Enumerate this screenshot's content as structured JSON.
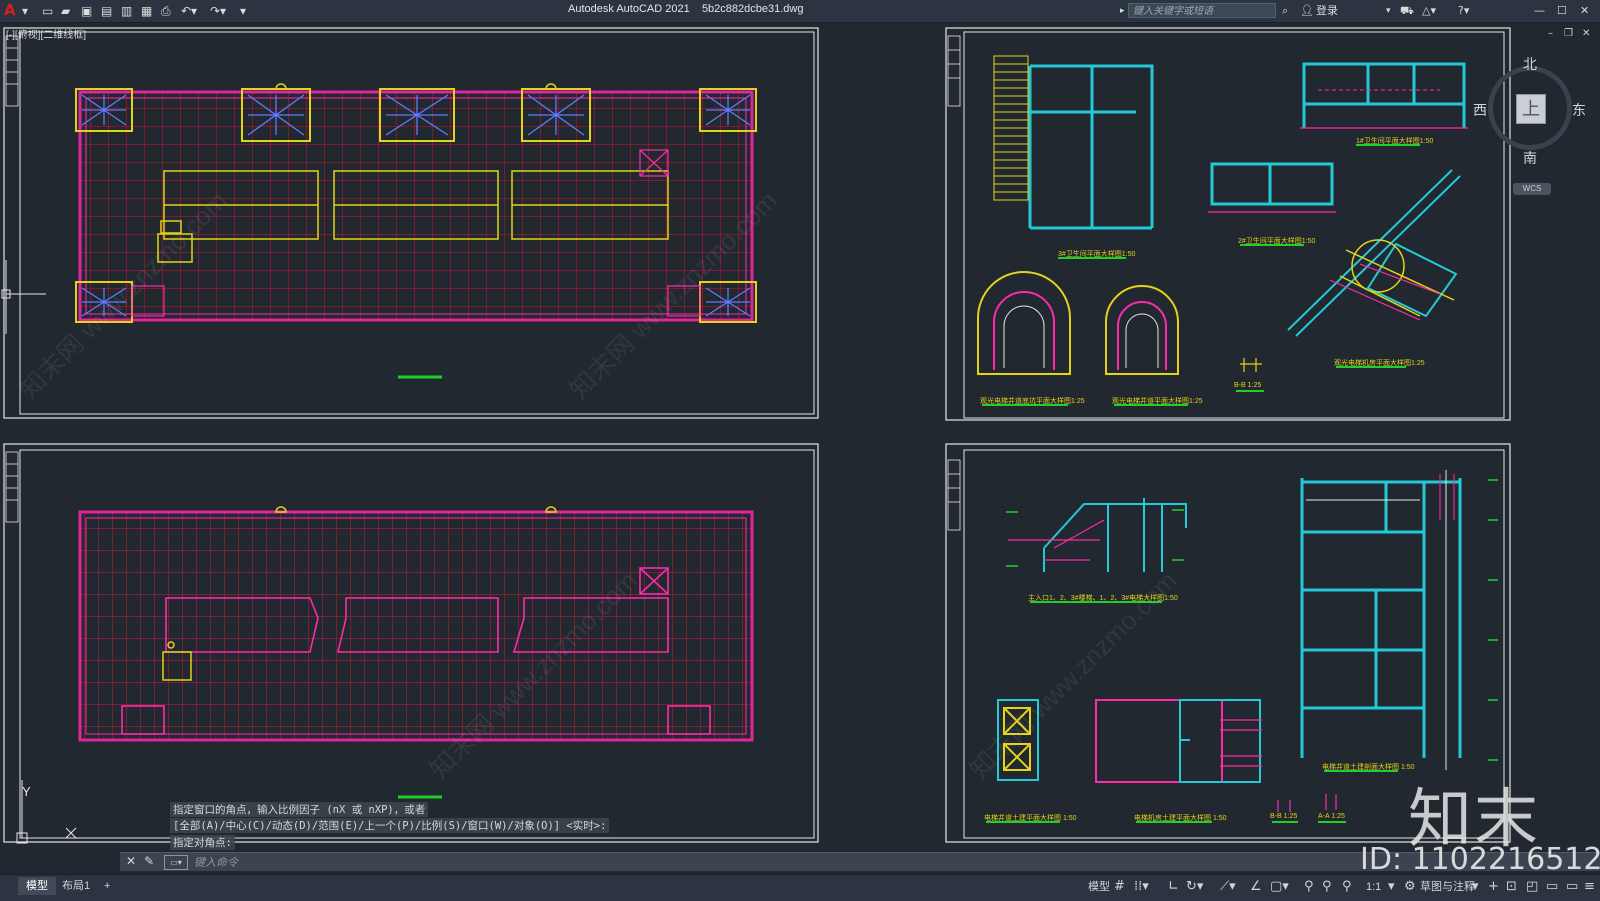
{
  "app": {
    "logo": "A",
    "title": "Autodesk AutoCAD 2021",
    "filename": "5b2c882dcbe31.dwg",
    "search_placeholder": "键入关键字或短语",
    "sign_in": "登录"
  },
  "viewport_label": "[-][俯视][二维线框]",
  "compass": {
    "north": "北",
    "south": "南",
    "east": "东",
    "west": "西",
    "top": "上",
    "wcs": "WCS"
  },
  "drawing_labels": {
    "toilet3": "3#卫生间平面大样图1:50",
    "toilet1": "1#卫生间平面大样图1:50",
    "toilet2": "2#卫生间平面大样图1:50",
    "elev_pit_top": "观光电梯井道底坑平面大样图1:25",
    "elev_pit_bottom": "观光电梯井道平面大样图1:25",
    "section_bb_small": "B-B 1:25",
    "elev_machine": "观光电梯机房平面大样图1:25",
    "stair_section": "主入口1、2、3#楼梯、1、2、3#电梯大样图1:50",
    "elev_shaft_plan": "电梯井道土建平面大样图 1:50",
    "machine_room": "电梯机房土建平面大样图 1:50",
    "section_bb": "B-B 1:25",
    "section_aa": "A-A 1:25",
    "elev_shaft_section": "电梯井道土建剖面大样图 1:50"
  },
  "command": {
    "history": [
      "指定窗口的角点，输入比例因子 (nX 或 nXP)，或者",
      "[全部(A)/中心(C)/动态(D)/范围(E)/上一个(P)/比例(S)/窗口(W)/对象(O)] <实时>:",
      "指定对角点:"
    ],
    "input_placeholder": "键入命令"
  },
  "status": {
    "tabs": [
      "模型",
      "布局1"
    ],
    "add_tab": "+",
    "model_label": "模型",
    "scale": "1:1",
    "workspace": "草图与注释"
  },
  "watermark": {
    "logo_text": "知末",
    "id_text": "ID: 1102216512",
    "site": "知末网 www.znzmo.com"
  }
}
